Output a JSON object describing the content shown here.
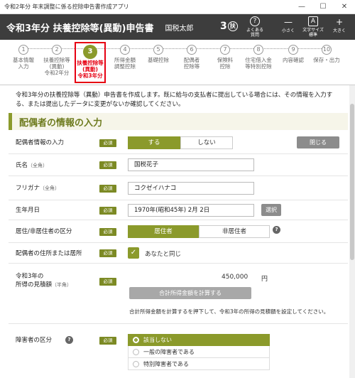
{
  "window": {
    "title": "令和2年分 年末調整に係る控除申告書作成アプリ",
    "min": "—",
    "max": "☐",
    "close": "✕"
  },
  "header": {
    "form_title": "令和3年分 扶養控除等(異動)申告書",
    "user": "国税太郎",
    "badge_num": "3",
    "badge_char": "扶",
    "buttons": [
      {
        "icon": "?",
        "label": "よくある\n質問"
      },
      {
        "icon": "—",
        "label": "小さく"
      },
      {
        "icon": "A",
        "label": "文字サイズ\n標準"
      },
      {
        "icon": "+",
        "label": "大きく"
      }
    ]
  },
  "steps": [
    {
      "num": "1",
      "label": "基本情報\n入力"
    },
    {
      "num": "2",
      "label": "扶養控除等\n(異動)\n令和2年分"
    },
    {
      "num": "3",
      "label": "扶養控除等\n(異動)\n令和3年分"
    },
    {
      "num": "4",
      "label": "所得金額\n調整控除"
    },
    {
      "num": "5",
      "label": "基礎控除"
    },
    {
      "num": "6",
      "label": "配偶者\n控除等"
    },
    {
      "num": "7",
      "label": "保険料\n控除"
    },
    {
      "num": "8",
      "label": "住宅借入金\n等特別控除"
    },
    {
      "num": "9",
      "label": "内容確認"
    },
    {
      "num": "10",
      "label": "保存・出力"
    }
  ],
  "intro": "令和3年分の扶養控除等（異動）申告書を作成します。既に給与の支払者に提出している場合には、その情報を入力する、または提出したデータに変更がないか確認してください。",
  "section_title": "配偶者の情報の入力",
  "required": "必須",
  "form": {
    "spouse_input": {
      "label": "配偶者情報の入力",
      "yes": "する",
      "no": "しない",
      "close": "閉じる"
    },
    "name": {
      "label": "氏名",
      "sub": "（全角）",
      "value": "国税花子"
    },
    "kana": {
      "label": "フリガナ",
      "sub": "（全角）",
      "value": "コクゼイハナコ"
    },
    "birthday": {
      "label": "生年月日",
      "value": "1970年(昭和45年) 2月 2日",
      "select": "選択"
    },
    "residence": {
      "label": "居住/非居住者の区分",
      "resident": "居住者",
      "nonresident": "非居住者",
      "help": "?"
    },
    "address": {
      "label": "配偶者の住所または居所",
      "check": "✓",
      "same": "あなたと同じ"
    },
    "income": {
      "label1": "令和3年の",
      "label2": "所得の見積額",
      "sub": "（半角）",
      "value": "450,000",
      "unit": "円",
      "calc": "合計所得金額を計算する",
      "note": "合計所得金額を計算するを押下して、令和3年の所得の見積額を設定してください。"
    },
    "disability": {
      "label": "障害者の区分",
      "help": "?",
      "options": [
        "該当しない",
        "一般の障害者である",
        "特別障害者である"
      ]
    }
  }
}
